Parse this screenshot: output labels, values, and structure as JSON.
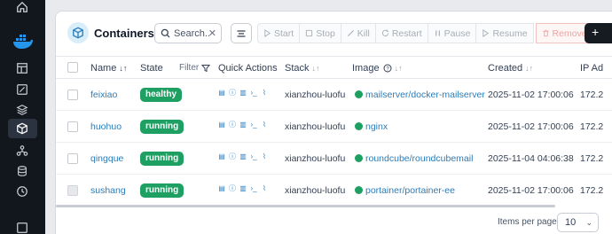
{
  "sidebar": {
    "icons": [
      "home-icon",
      "docker-logo",
      "dashboard-icon",
      "edit-icon",
      "layers-icon",
      "container-icon",
      "network-icon",
      "database-icon",
      "clock-icon",
      "registry-icon"
    ],
    "active": "container-icon"
  },
  "header": {
    "title": "Containers",
    "search_placeholder": "Search..",
    "actions": [
      "Start",
      "Stop",
      "Kill",
      "Restart",
      "Pause",
      "Resume",
      "Remove"
    ],
    "add_label": "+"
  },
  "table": {
    "columns": {
      "name": "Name",
      "state": "State",
      "filter": "Filter",
      "quick_actions": "Quick Actions",
      "stack": "Stack",
      "image": "Image",
      "created": "Created",
      "ip": "IP Ad"
    },
    "rows": [
      {
        "name": "feixiao",
        "state": "healthy",
        "stack": "xianzhou-luofu",
        "image": "mailserver/docker-mailserver",
        "created": "2025-11-02 17:00:06",
        "ip": "172.2"
      },
      {
        "name": "huohuo",
        "state": "running",
        "stack": "xianzhou-luofu",
        "image": "nginx",
        "created": "2025-11-02 17:00:06",
        "ip": "172.2"
      },
      {
        "name": "qingque",
        "state": "running",
        "stack": "xianzhou-luofu",
        "image": "roundcube/roundcubemail",
        "created": "2025-11-04 04:06:38",
        "ip": "172.2"
      },
      {
        "name": "sushang",
        "state": "running",
        "stack": "xianzhou-luofu",
        "image": "portainer/portainer-ee",
        "created": "2025-11-02 17:00:06",
        "ip": "172.2"
      }
    ]
  },
  "footer": {
    "items_per_page_label": "Items per page",
    "items_per_page_value": "10"
  },
  "colors": {
    "accent_link": "#2c7cb8",
    "status_green": "#1ea062",
    "sidebar_bg": "#12161d",
    "remove_red": "#f2a3a3"
  }
}
